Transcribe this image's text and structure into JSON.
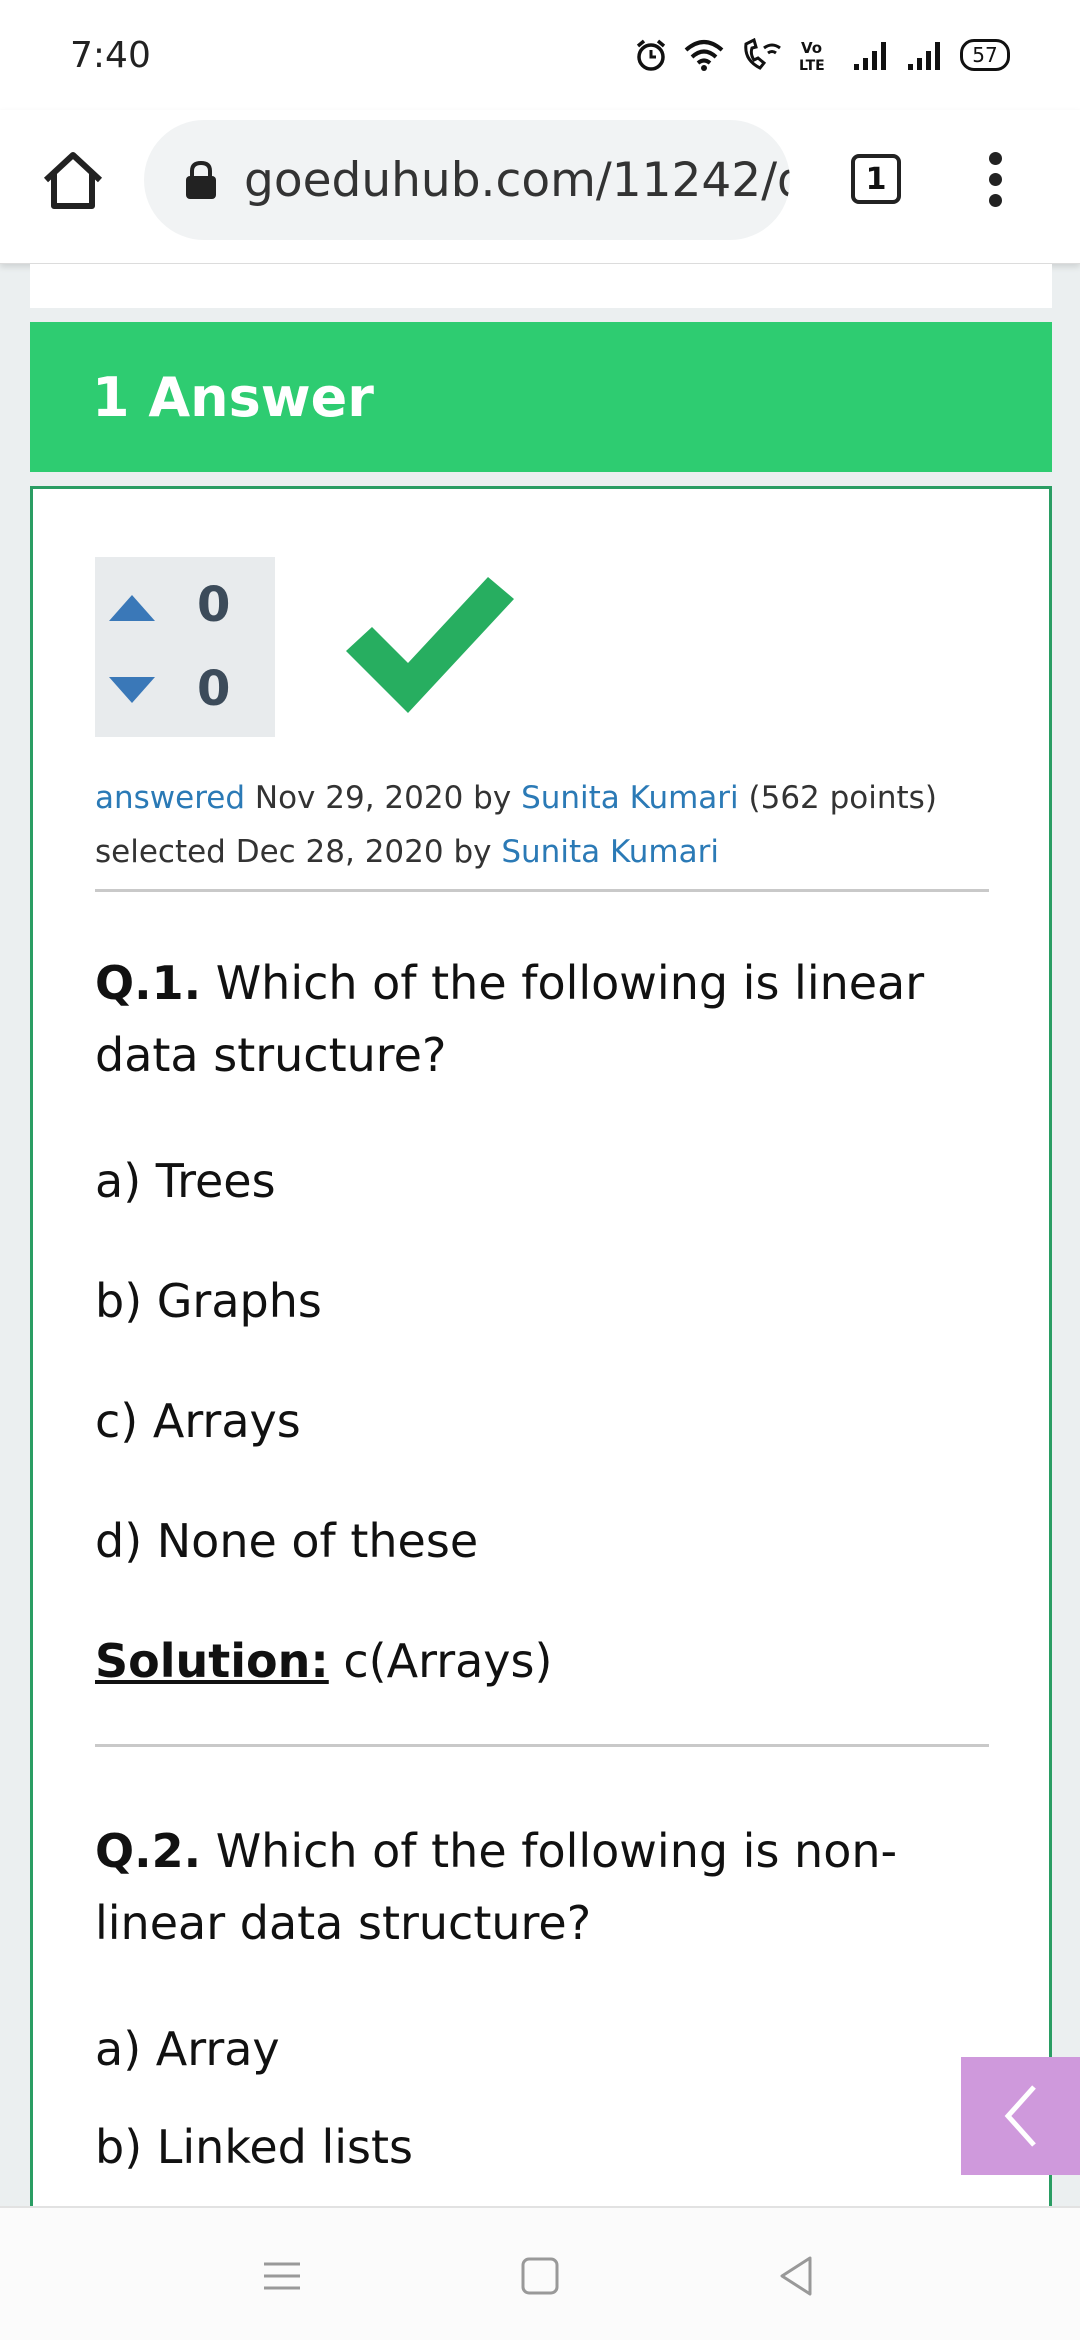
{
  "status_bar": {
    "time": "7:40",
    "battery": "57",
    "volte": "Vo\nLTE",
    "icons": [
      "alarm-icon",
      "wifi-icon",
      "wifi-calling-icon",
      "volte-icon",
      "signal-icon",
      "signal-icon-2",
      "battery-icon"
    ]
  },
  "browser": {
    "url": "goeduhub.com/11242/d",
    "tab_count": "1"
  },
  "answer_header": {
    "title": "1 Answer"
  },
  "answer": {
    "votes_up": "0",
    "votes_down": "0",
    "meta": {
      "answered_link": "answered",
      "answered_date": "Nov 29, 2020",
      "by": "by",
      "author": "Sunita Kumari",
      "points": "(562 points)",
      "selected_prefix": "selected",
      "selected_date": "Dec 28, 2020",
      "selected_by": "by",
      "selected_author": "Sunita Kumari"
    }
  },
  "q1": {
    "number": "Q.1.",
    "text": "Which of the following is linear data structure?",
    "options": [
      "a) Trees",
      "b) Graphs",
      "c) Arrays",
      "d) None of these"
    ],
    "solution_label": "Solution:",
    "solution_value": "c(Arrays)"
  },
  "q2": {
    "number": "Q.2.",
    "text": "Which of the following is non-linear data structure?",
    "options": [
      "a) Array",
      "b) Linked lists"
    ]
  },
  "colors": {
    "header_green": "#2ecc71",
    "link_blue": "#2b7ab6",
    "check_green": "#27ae60",
    "side_tab_purple": "#cf99dc"
  }
}
